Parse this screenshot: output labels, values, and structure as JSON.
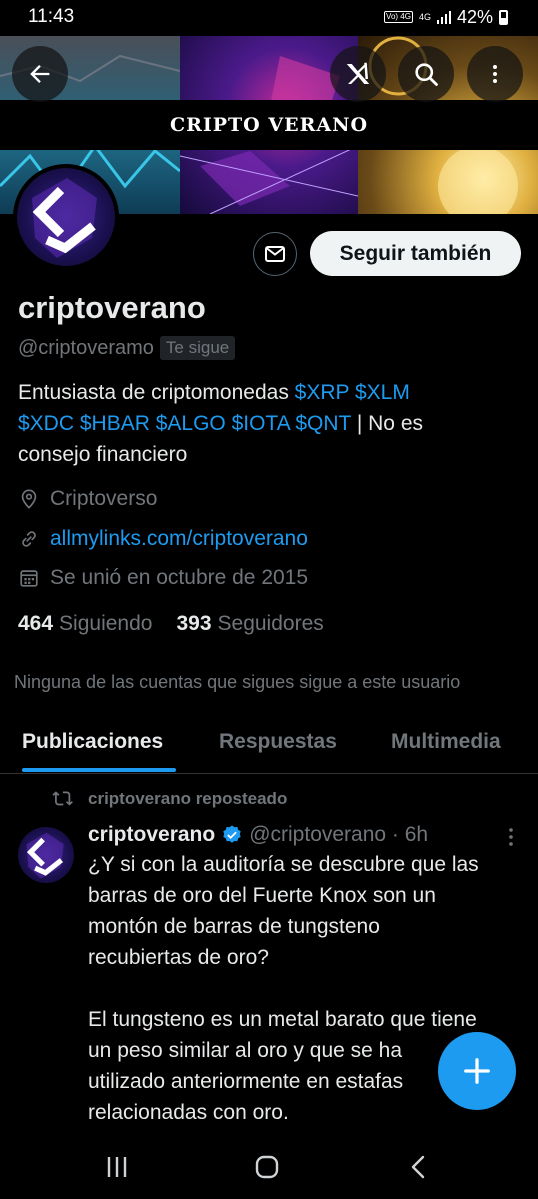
{
  "status_bar": {
    "time": "11:43",
    "volte_label": "Vo) 4G",
    "network": "4G",
    "battery": "42%"
  },
  "banner": {
    "title": "CRIPTO VERANO"
  },
  "header_actions": {
    "back_icon": "arrow-left-icon",
    "grok_icon": "grok-icon",
    "search_icon": "search-icon",
    "more_icon": "more-vertical-icon"
  },
  "profile": {
    "message_icon": "envelope-icon",
    "follow_button_label": "Seguir también",
    "display_name": "criptoverano",
    "handle": "@criptoveramo",
    "follows_you_badge": "Te sigue",
    "bio": {
      "text_1": "Entusiasta de criptomonedas ",
      "cashtags_1": "$XRP $XLM",
      "cashtags_2": "$XDC $HBAR $ALGO $IOTA $QNT",
      "text_2": " | No es",
      "text_3": "consejo financiero"
    },
    "location": "Criptoverso",
    "website": "allmylinks.com/criptoverano",
    "joined": "Se unió en octubre de 2015",
    "following_count": "464",
    "following_label": "Siguiendo",
    "followers_count": "393",
    "followers_label": "Seguidores",
    "no_mutuals": "Ninguna de las cuentas que sigues sigue a este usuario"
  },
  "tabs": [
    {
      "label": "Publicaciones",
      "active": true
    },
    {
      "label": "Respuestas",
      "active": false
    },
    {
      "label": "Multimedia",
      "active": false
    }
  ],
  "post": {
    "repost_label": "criptoverano reposteado",
    "author": "criptoverano",
    "handle_time": "@criptoverano · 6h",
    "body": "¿Y si con la auditoría se descubre que las\nbarras de oro del Fuerte Knox son un\nmontón de barras de tungsteno\nrecubiertas de oro?\n\nEl tungsteno es un metal barato que tiene\nun peso similar al oro y que se ha\nutilizado anteriormente en estafas\nrelacionadas con oro."
  },
  "colors": {
    "accent": "#1d9bf0",
    "background": "#000000",
    "text_primary": "#e7e9ea",
    "text_secondary": "#71767b"
  }
}
